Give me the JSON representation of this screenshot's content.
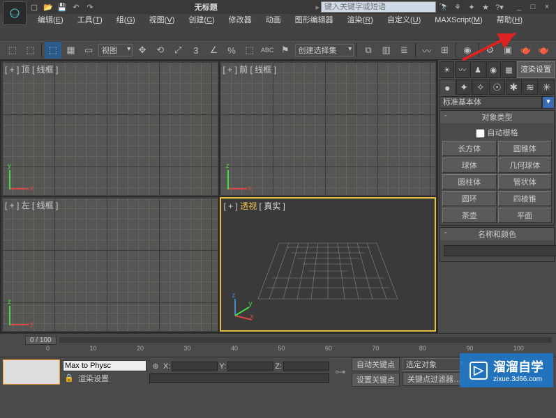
{
  "window": {
    "title": "无标题",
    "min": "_",
    "restore": "□",
    "close": "×"
  },
  "search": {
    "placeholder": "键入关键字或短语"
  },
  "menu": [
    {
      "label": "编辑",
      "hk": "E"
    },
    {
      "label": "工具",
      "hk": "T"
    },
    {
      "label": "组",
      "hk": "G"
    },
    {
      "label": "视图",
      "hk": "V"
    },
    {
      "label": "创建",
      "hk": "C"
    },
    {
      "label": "修改器",
      "hk": ""
    },
    {
      "label": "动画",
      "hk": ""
    },
    {
      "label": "图形编辑器",
      "hk": ""
    },
    {
      "label": "渲染",
      "hk": "R"
    },
    {
      "label": "自定义",
      "hk": "U"
    },
    {
      "label": "MAXScript",
      "hk": "M"
    },
    {
      "label": "帮助",
      "hk": "H"
    }
  ],
  "toolbar": {
    "ref_coord": "视图",
    "selection_set": "创建选择集"
  },
  "viewports": {
    "top": "[ + ] 顶 [ 线框 ]",
    "front": "[ + ] 前 [ 线框 ]",
    "left": "[ + ] 左 [ 线框 ]",
    "persp_pre": "[ + ] ",
    "persp_mid": "透视",
    "persp_post": " [ 真实 ]"
  },
  "panel": {
    "render_setup": "渲染设置",
    "category": "标准基本体",
    "section_type": "对象类型",
    "autogrid": "自动栅格",
    "primitives": [
      "长方体",
      "圆锥体",
      "球体",
      "几何球体",
      "圆柱体",
      "管状体",
      "圆环",
      "四棱锥",
      "茶壶",
      "平面"
    ],
    "section_name": "名称和颜色"
  },
  "timeline": {
    "slider": "0 / 100",
    "ticks": [
      "0",
      "10",
      "20",
      "30",
      "40",
      "50",
      "60",
      "70",
      "80",
      "90",
      "100"
    ]
  },
  "status": {
    "script": "Max to Physc",
    "render_setting": "渲染设置",
    "x": "X:",
    "y": "Y:",
    "z": "Z:",
    "autokey": "自动关键点",
    "setkey": "设置关键点",
    "sel_obj": "选定对象",
    "key_filter": "关键点过滤器…"
  },
  "watermark": {
    "text": "溜溜自学",
    "domain": "zixue.3d66.com"
  }
}
